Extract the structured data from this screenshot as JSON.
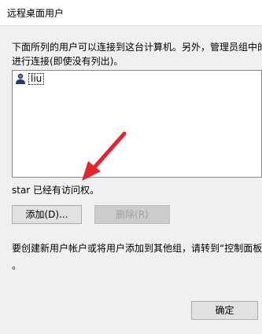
{
  "window": {
    "title": "远程桌面用户"
  },
  "dialog": {
    "description_line1": "下面所列的用户可以连接到这台计算机。另外，管理员组中的",
    "description_line2": "进行连接(即使没有列出)。",
    "users": [
      {
        "name": "liu",
        "icon": "user-icon"
      }
    ],
    "access_text": "star 已经有访问权。",
    "add_button": "添加(D)...",
    "remove_button": "删除(R)",
    "hint_line1": "要创建新用户帐户或将用户添加到其他组，请转到“控制面板",
    "hint_line2": "。",
    "ok_button": "确定"
  },
  "annotation": {
    "arrow_color": "#e8222a"
  }
}
